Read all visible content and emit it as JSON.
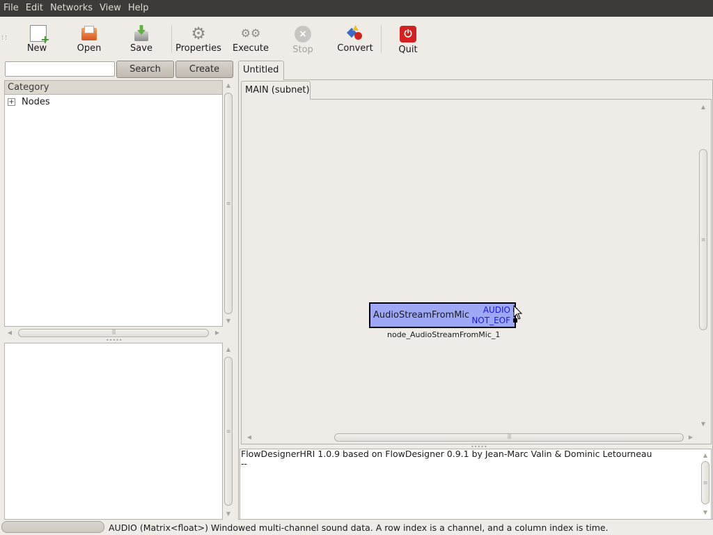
{
  "menubar": {
    "items": [
      "File",
      "Edit",
      "Networks",
      "View",
      "Help"
    ]
  },
  "toolbar": {
    "new_label": "New",
    "open_label": "Open",
    "save_label": "Save",
    "properties_label": "Properties",
    "execute_label": "Execute",
    "stop_label": "Stop",
    "convert_label": "Convert",
    "quit_label": "Quit"
  },
  "search": {
    "value": "",
    "placeholder": "",
    "search_label": "Search",
    "create_label": "Create"
  },
  "tree": {
    "header": "Category",
    "items": [
      {
        "label": "Nodes",
        "expander": "+"
      }
    ]
  },
  "notebook": {
    "tab_label": "Untitled",
    "subtab_label": "MAIN (subnet)"
  },
  "node": {
    "name": "AudioStreamFromMic",
    "outputs": [
      "AUDIO",
      "NOT_EOF"
    ],
    "label": "node_AudioStreamFromMic_1",
    "fill_color": "#9fa8f5",
    "port_color": "#1a1ae0"
  },
  "log": {
    "lines": [
      "FlowDesignerHRI 1.0.9 based on FlowDesigner 0.9.1 by Jean-Marc Valin & Dominic Letourneau",
      "--"
    ]
  },
  "status": {
    "text": "AUDIO (Matrix<float>) Windowed multi-channel sound data. A row index is a channel, and a column index is time."
  },
  "icons": {
    "new": "new-file-icon",
    "open": "open-folder-icon",
    "save": "save-icon",
    "properties": "gear-icon",
    "execute": "gears-icon",
    "stop": "stop-icon",
    "convert": "convert-icon",
    "quit": "power-icon"
  }
}
